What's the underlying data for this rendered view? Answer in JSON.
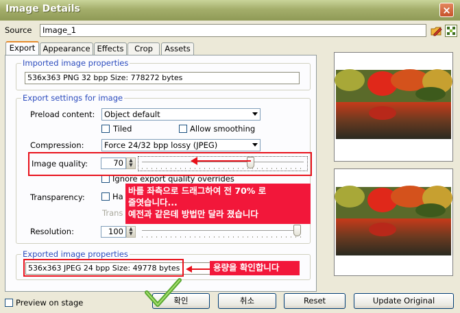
{
  "window": {
    "title": "Image Details",
    "close_glyph": "×"
  },
  "source": {
    "label": "Source",
    "value": "Image_1",
    "icons": [
      "edit-image-icon",
      "browse-library-icon"
    ]
  },
  "tabs": [
    {
      "label": "Export",
      "active": true
    },
    {
      "label": "Appearance",
      "active": false
    },
    {
      "label": "Effects",
      "active": false
    },
    {
      "label": "Crop",
      "active": false
    },
    {
      "label": "Assets",
      "active": false
    }
  ],
  "imported": {
    "legend": "Imported image properties",
    "info": "536x363 PNG 32 bpp Size: 778272 bytes"
  },
  "export_settings": {
    "legend": "Export settings for image",
    "preload_label": "Preload content:",
    "preload_value": "Object default",
    "tiled_label": "Tiled",
    "smoothing_label": "Allow smoothing",
    "compression_label": "Compression:",
    "compression_value": "Force 24/32 bpp lossy (JPEG)",
    "quality_label": "Image quality:",
    "quality_value": "70",
    "quality_level": 0.7,
    "ignore_label": "Ignore export quality overrides",
    "transparency_label": "Transparency:",
    "transparency_option": "Ha",
    "trans_label": "Trans",
    "resolution_label": "Resolution:",
    "resolution_value": "100",
    "resolution_level": 1.0
  },
  "exported": {
    "legend": "Exported image properties",
    "info": "536x363 JPEG 24 bpp Size: 49778 bytes"
  },
  "annotations": {
    "note_line1": "바를 좌측으로 드래그하여 전 70% 로",
    "note_line2": "줄엿습니다...",
    "note_line3": "예전과 같은데 방법만 달라 졌습니다",
    "size_note": "용량을 확인합니다",
    "accent_color": "#f2173a"
  },
  "footer": {
    "preview_label": "Preview on stage",
    "ok_label": "확인",
    "cancel_label": "취소",
    "reset_label": "Reset",
    "update_label": "Update Original"
  }
}
